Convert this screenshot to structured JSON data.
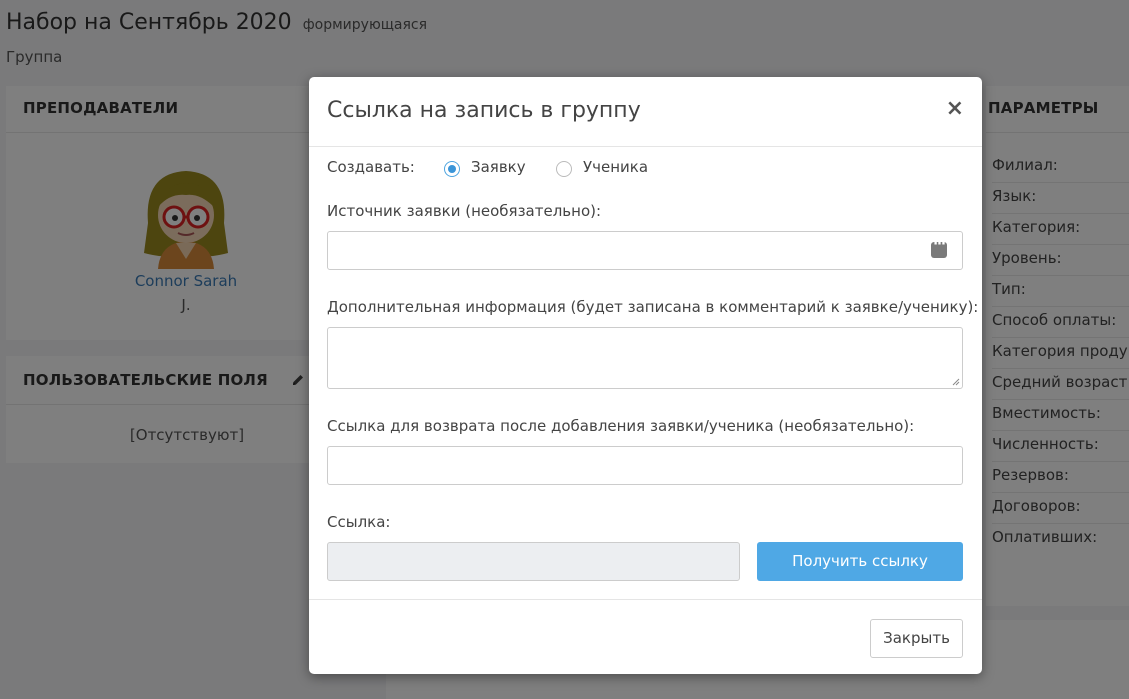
{
  "page": {
    "title": "Набор на Сентябрь 2020",
    "status": "формирующаяся",
    "subtitle": "Группа"
  },
  "teachers": {
    "heading": "ПРЕПОДАВАТЕЛИ",
    "name_line1": "Connor Sarah",
    "name_line2": "J."
  },
  "custom_fields": {
    "heading": "ПОЛЬЗОВАТЕЛЬСКИЕ ПОЛЯ",
    "empty_text": "[Отсутствуют]",
    "edit_icon": "pencil-icon"
  },
  "parameters": {
    "heading": "ПАРАМЕТРЫ",
    "rows": [
      "Филиал:",
      "Язык:",
      "Категория:",
      "Уровень:",
      "Тип:",
      "Способ оплаты:",
      "Категория продук",
      "Средний возраст:",
      "Вместимость:",
      "Численность:",
      "Резервов:",
      "Договоров:",
      "Оплативших:"
    ]
  },
  "modal": {
    "title": "Ссылка на запись в группу",
    "close_label": "×",
    "create_label": "Создавать:",
    "radio_options": [
      "Заявку",
      "Ученика"
    ],
    "selected_option": "Заявку",
    "source_label": "Источник заявки (необязательно):",
    "source_value": "",
    "source_icon": "more-options-icon",
    "extra_info_label": "Дополнительная информация (будет записана в комментарий к заявке/ученику):",
    "extra_info_value": "",
    "return_link_label": "Ссылка для возврата после добавления заявки/ученика (необязательно):",
    "return_link_value": "",
    "link_label": "Ссылка:",
    "link_value": "",
    "get_link_button": "Получить ссылку",
    "close_button": "Закрыть"
  },
  "colors": {
    "accent": "#4fa8e5",
    "link": "#3a7bb6",
    "overlay": "rgba(0,0,0,0.5)"
  }
}
